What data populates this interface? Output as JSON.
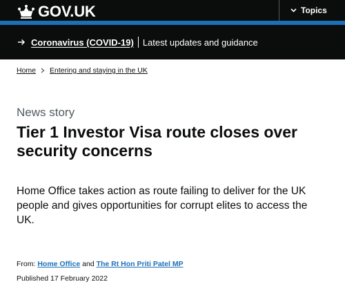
{
  "header": {
    "logo_text": "GOV.UK",
    "topics_label": "Topics"
  },
  "covid_banner": {
    "link_text": "Coronavirus (COVID-19)",
    "description": "Latest updates and guidance"
  },
  "breadcrumb": {
    "items": [
      "Home",
      "Entering and staying in the UK"
    ]
  },
  "article": {
    "kicker": "News story",
    "title": "Tier 1 Investor Visa route closes over security concerns",
    "lead": "Home Office takes action as route failing to deliver for the UK people and gives opportunities for corrupt elites to access the UK.",
    "from_label": "From:",
    "from_org": "Home Office",
    "from_and": "and",
    "from_person": "The Rt Hon Priti Patel MP",
    "published_label": "Published",
    "published_date": "17 February 2022"
  },
  "colors": {
    "header_bg": "#0b0c0c",
    "accent_blue": "#1d70b8",
    "text": "#0b0c0c",
    "secondary_text": "#505a5f"
  },
  "icons": [
    "crown-icon",
    "chevron-down-icon",
    "arrow-right-icon",
    "breadcrumb-chevron-icon"
  ]
}
